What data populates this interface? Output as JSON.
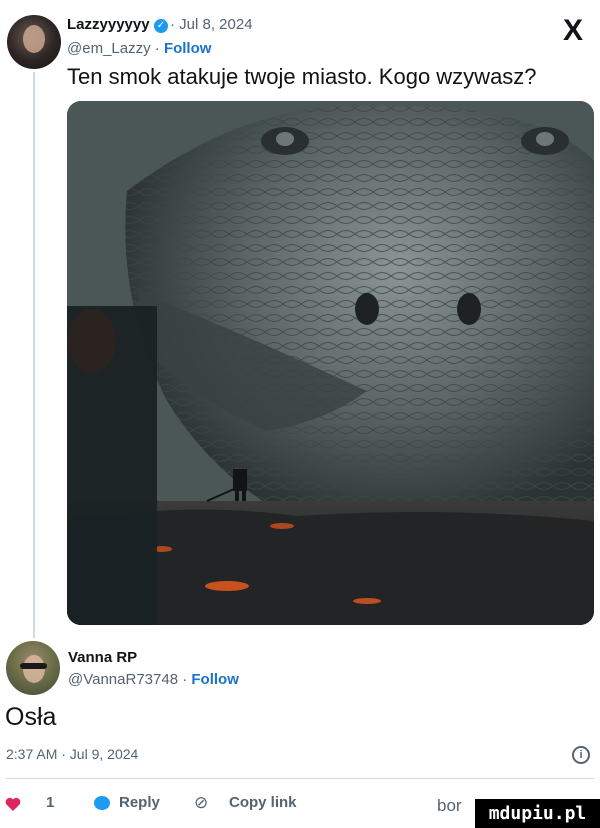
{
  "tweet": {
    "author_name": "Lazzyyyyyy",
    "date": "· Jul 8, 2024",
    "handle": "@em_Lazzy ·",
    "follow_label": "Follow",
    "text": "Ten smok atakuje twoje miasto. Kogo wzywasz?",
    "image_description": "Giant stone-scaled dragon head facing a lone armored figure on burning volcanic ground"
  },
  "reply": {
    "author_name": "Vanna RP",
    "handle": "@VannaR73748 ·",
    "follow_label": "Follow",
    "text": "Osła",
    "timestamp": "2:37 AM · Jul 9, 2024"
  },
  "actions": {
    "like_count": "1",
    "reply_label": "Reply",
    "copy_link_label": "Copy link",
    "more_partial": "bor"
  },
  "watermark": "mdupiu.pl",
  "colors": {
    "follow": "#1d72c9",
    "like": "#e0245e",
    "reply": "#1d9bf0"
  }
}
